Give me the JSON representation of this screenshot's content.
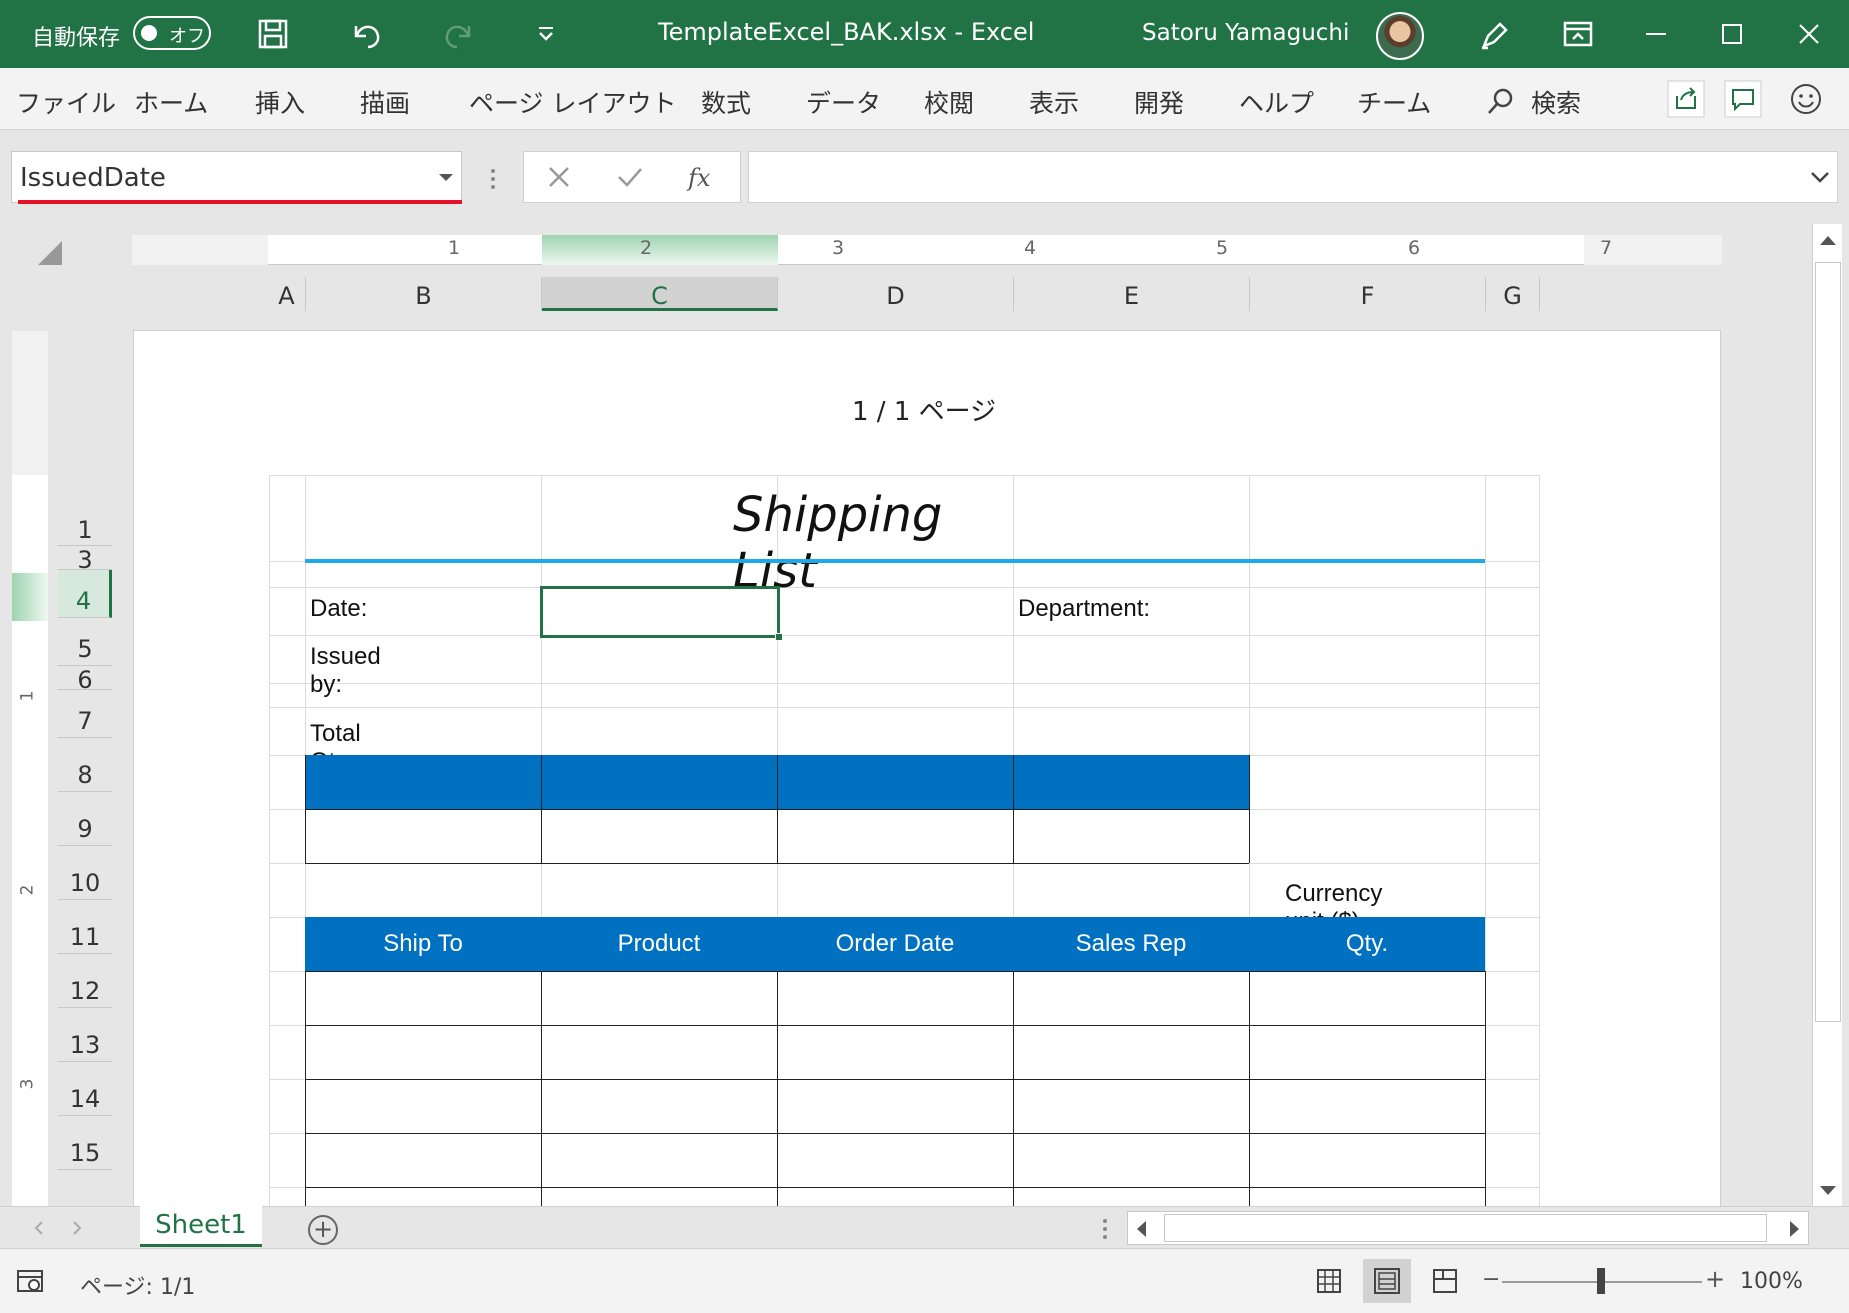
{
  "titlebar": {
    "autosave_label": "自動保存",
    "autosave_state": "オフ",
    "doc_title": "TemplateExcel_BAK.xlsx  -  Excel",
    "user_name": "Satoru Yamaguchi"
  },
  "menu": {
    "items": [
      "ファイル",
      "ホーム",
      "挿入",
      "描画",
      "ページ レイアウト",
      "数式",
      "データ",
      "校閲",
      "表示",
      "開発",
      "ヘルプ",
      "チーム"
    ],
    "search_label": "検索"
  },
  "formula_bar": {
    "name_box": "IssuedDate",
    "formula_value": ""
  },
  "ruler": {
    "numbers": [
      "1",
      "2",
      "3",
      "4",
      "5",
      "6",
      "7"
    ],
    "vertical_numbers": [
      "1",
      "2",
      "3"
    ]
  },
  "columns": [
    "A",
    "B",
    "C",
    "D",
    "E",
    "F",
    "G"
  ],
  "rows": [
    "1",
    "3",
    "4",
    "5",
    "6",
    "7",
    "8",
    "9",
    "10",
    "11",
    "12",
    "13",
    "14",
    "15"
  ],
  "page": {
    "header": "1 / 1 ページ",
    "title": "Shipping List",
    "date_label": "Date:",
    "issued_by_label": "Issued by:",
    "department_label": "Department:",
    "total_qty_label": "Total Qty.",
    "currency_label": "Currency unit ($)",
    "table_headers": [
      "Ship To",
      "Product",
      "Order Date",
      "Sales Rep",
      "Qty."
    ]
  },
  "sheet_tabs": [
    "Sheet1"
  ],
  "status": {
    "page_info": "ページ: 1/1",
    "zoom": "100%"
  },
  "colors": {
    "excel_green": "#217346",
    "header_blue": "#0070c0",
    "title_line": "#1eaae7",
    "namebox_underline": "#e81123"
  }
}
